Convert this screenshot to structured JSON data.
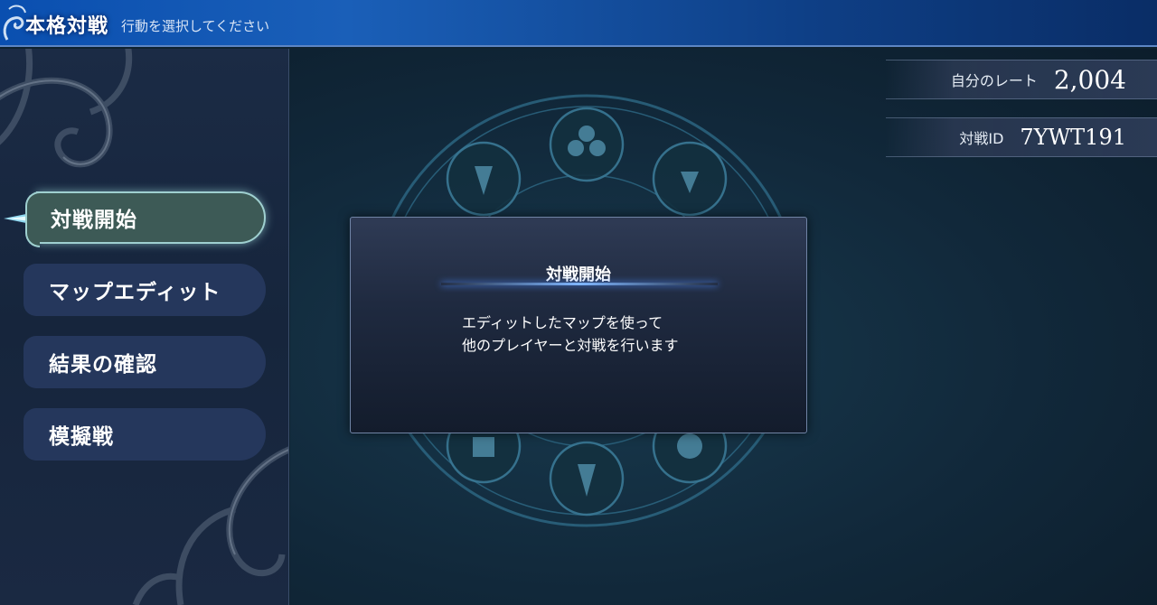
{
  "header": {
    "title": "本格対戦",
    "subtitle": "行動を選択してください"
  },
  "menu": {
    "items": [
      {
        "label": "対戦開始",
        "active": true
      },
      {
        "label": "マップエディット",
        "active": false
      },
      {
        "label": "結果の確認",
        "active": false
      },
      {
        "label": "模擬戦",
        "active": false
      }
    ]
  },
  "stats": {
    "rate_label": "自分のレート",
    "rate_value": "2,004",
    "battle_id_label": "対戦ID",
    "battle_id_value": "7YWT191"
  },
  "dialog": {
    "title": "対戦開始",
    "line1": "エディットしたマップを使って",
    "line2": "他のプレイヤーと対戦を行います"
  },
  "colors": {
    "header_bar": "#1a5fb8",
    "active_item": "#3d5a56",
    "active_border": "#9fd0d0",
    "menu_item": "#25375c"
  }
}
